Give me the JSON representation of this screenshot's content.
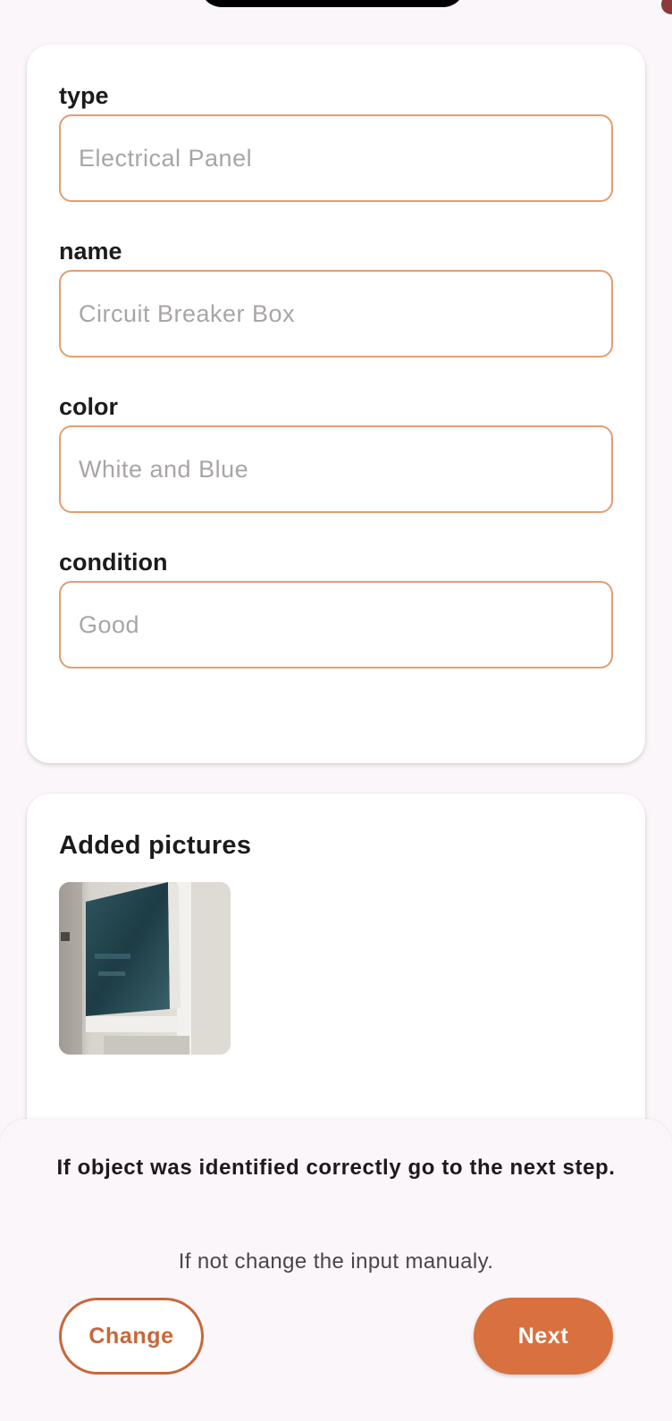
{
  "form": {
    "fields": [
      {
        "label": "type",
        "placeholder": "Electrical Panel",
        "value": ""
      },
      {
        "label": "name",
        "placeholder": "Circuit Breaker Box",
        "value": ""
      },
      {
        "label": "color",
        "placeholder": "White and Blue",
        "value": ""
      },
      {
        "label": "condition",
        "placeholder": "Good",
        "value": ""
      }
    ]
  },
  "pictures": {
    "title": "Added pictures",
    "count": 1
  },
  "sheet": {
    "message": "If object was identified correctly go to the next step.",
    "hint": "If not change the input manualy.",
    "change_label": "Change",
    "next_label": "Next"
  },
  "colors": {
    "accent": "#d9703f",
    "input_border": "#e39d71",
    "background": "#fbf6f9"
  }
}
